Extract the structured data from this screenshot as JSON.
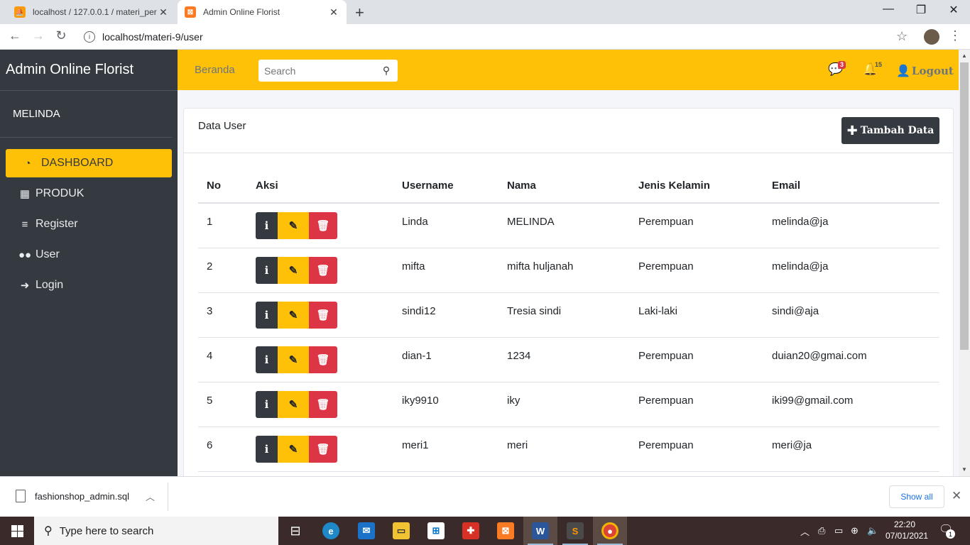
{
  "browser": {
    "tabs": [
      {
        "title": "localhost / 127.0.0.1 / materi_per"
      },
      {
        "title": "Admin Online Florist"
      }
    ],
    "url": "localhost/materi-9/user"
  },
  "sidebar": {
    "brand": "Admin Online Florist",
    "user": "MELINDA",
    "items": [
      {
        "label": "DASHBOARD",
        "icon": "tachometer-icon"
      },
      {
        "label": "PRODUK",
        "icon": "warehouse-icon"
      },
      {
        "label": "Register",
        "icon": "bars-icon"
      },
      {
        "label": "User",
        "icon": "users-icon"
      },
      {
        "label": "Login",
        "icon": "sign-in-icon"
      }
    ]
  },
  "topnav": {
    "home_label": "Beranda",
    "search_placeholder": "Search",
    "messages_badge": "3",
    "notifications_badge": "15",
    "logout_label": "Logout"
  },
  "card": {
    "title": "Data User",
    "add_button": "Tambah Data"
  },
  "table": {
    "headers": [
      "No",
      "Aksi",
      "Username",
      "Nama",
      "Jenis Kelamin",
      "Email"
    ],
    "rows": [
      {
        "no": "1",
        "username": "Linda",
        "nama": "MELINDA",
        "jk": "Perempuan",
        "email": "melinda@ja"
      },
      {
        "no": "2",
        "username": "mifta",
        "nama": "mifta huljanah",
        "jk": "Perempuan",
        "email": "melinda@ja"
      },
      {
        "no": "3",
        "username": "sindi12",
        "nama": "Tresia sindi",
        "jk": "Laki-laki",
        "email": "sindi@aja"
      },
      {
        "no": "4",
        "username": "dian-1",
        "nama": "1234",
        "jk": "Perempuan",
        "email": "duian20@gmai.com"
      },
      {
        "no": "5",
        "username": "iky9910",
        "nama": "iky",
        "jk": "Perempuan",
        "email": "iki99@gmail.com"
      },
      {
        "no": "6",
        "username": "meri1",
        "nama": "meri",
        "jk": "Perempuan",
        "email": "meri@ja"
      }
    ]
  },
  "downloads": {
    "file": "fashionshop_admin.sql",
    "show_all": "Show all"
  },
  "taskbar": {
    "search_placeholder": "Type here to search",
    "time": "22:20",
    "date": "07/01/2021",
    "notifications": "1"
  },
  "colors": {
    "accent_yellow": "#ffc107",
    "sidebar_dark": "#343a40",
    "danger": "#dc3545"
  }
}
